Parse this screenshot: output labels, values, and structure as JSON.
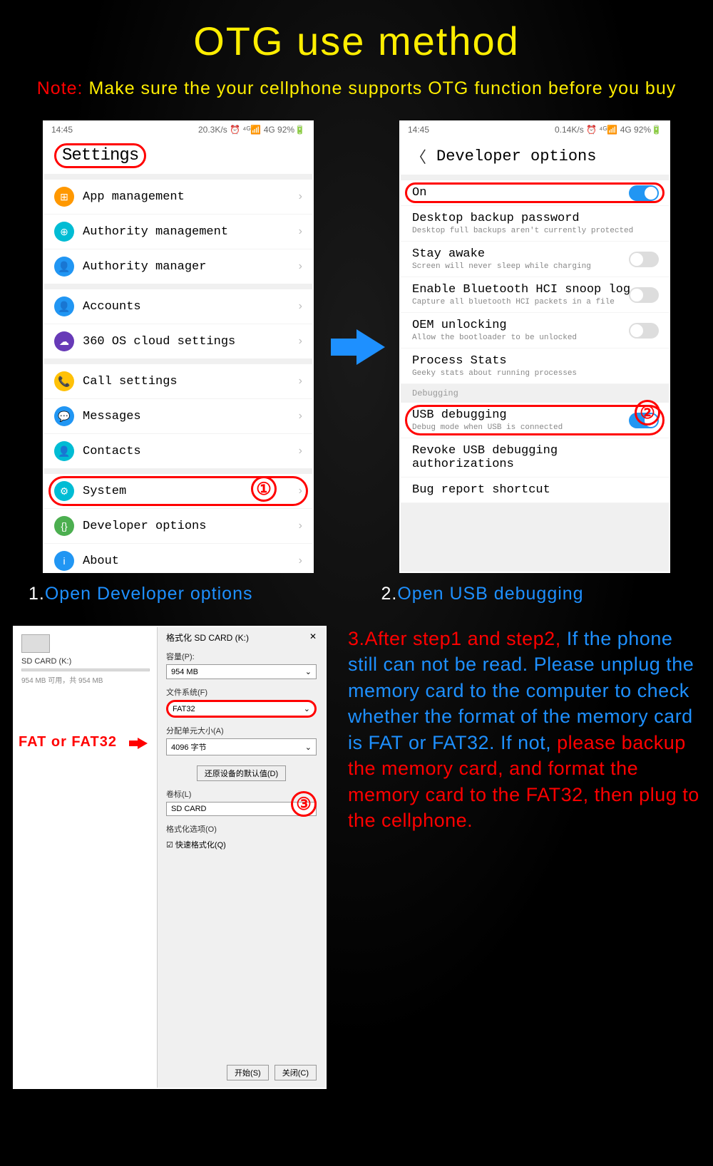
{
  "title": "OTG use method",
  "note_label": "Note:",
  "note_text": "Make sure the your cellphone supports OTG function before you buy",
  "phone1": {
    "status_time": "14:45",
    "status_right": "20.3K/s ⏰ ⁴ᴳ📶 4G 92%🔋",
    "header": "Settings",
    "groups": [
      [
        {
          "icon": "⊞",
          "color": "#ff9800",
          "label": "App management"
        },
        {
          "icon": "⊕",
          "color": "#00bcd4",
          "label": "Authority management"
        },
        {
          "icon": "👤",
          "color": "#2196f3",
          "label": "Authority manager"
        }
      ],
      [
        {
          "icon": "👤",
          "color": "#2196f3",
          "label": "Accounts"
        },
        {
          "icon": "☁",
          "color": "#673ab7",
          "label": "360 OS cloud settings"
        }
      ],
      [
        {
          "icon": "📞",
          "color": "#ffc107",
          "label": "Call settings"
        },
        {
          "icon": "💬",
          "color": "#2196f3",
          "label": "Messages"
        },
        {
          "icon": "👤",
          "color": "#00bcd4",
          "label": "Contacts"
        }
      ],
      [
        {
          "icon": "⚙",
          "color": "#00bcd4",
          "label": "System",
          "highlight": true
        },
        {
          "icon": "{}",
          "color": "#4caf50",
          "label": "Developer options"
        },
        {
          "icon": "i",
          "color": "#2196f3",
          "label": "About"
        }
      ]
    ]
  },
  "phone2": {
    "status_time": "14:45",
    "status_right": "0.14K/s ⏰ ⁴ᴳ📶 4G 92%🔋",
    "header": "Developer options",
    "rows": [
      {
        "title": "On",
        "sub": "",
        "toggle": "on",
        "highlight": true
      },
      {
        "title": "Desktop backup password",
        "sub": "Desktop full backups aren't currently protected"
      },
      {
        "title": "Stay awake",
        "sub": "Screen will never sleep while charging",
        "toggle": "off"
      },
      {
        "title": "Enable Bluetooth HCI snoop log",
        "sub": "Capture all bluetooth HCI packets in a file",
        "toggle": "off"
      },
      {
        "title": "OEM unlocking",
        "sub": "Allow the bootloader to be unlocked",
        "toggle": "off"
      },
      {
        "title": "Process Stats",
        "sub": "Geeky stats about running processes"
      }
    ],
    "debug_label": "Debugging",
    "debug_rows": [
      {
        "title": "USB debugging",
        "sub": "Debug mode when USB is connected",
        "toggle": "on",
        "highlight": true
      },
      {
        "title": "Revoke USB debugging authorizations",
        "sub": ""
      },
      {
        "title": "Bug report shortcut",
        "sub": ""
      }
    ]
  },
  "caption1_num": "1.",
  "caption1_text": "Open Developer options",
  "caption2_num": "2.",
  "caption2_text": "Open USB debugging",
  "format": {
    "drive_label": "SD CARD (K:)",
    "drive_sub": "954 MB 可用，共 954 MB",
    "dlg_title": "格式化 SD CARD (K:)",
    "capacity_label": "容量(P):",
    "capacity_value": "954 MB",
    "fs_label": "文件系统(F)",
    "fs_value": "FAT32",
    "alloc_label": "分配单元大小(A)",
    "alloc_value": "4096 字节",
    "restore_btn": "还原设备的默认值(D)",
    "vol_label": "卷标(L)",
    "vol_value": "SD CARD",
    "opt_label": "格式化选项(O)",
    "quick_label": "快速格式化(Q)",
    "start_btn": "开始(S)",
    "close_btn": "关闭(C)",
    "fat_hint": "FAT or FAT32"
  },
  "instr_num": "3.",
  "instr_red1": "After step1 and step2,",
  "instr_blue1": "If the phone still can not be read. Please unplug the memory card to the computer to check whether the format of the memory card is FAT or FAT32. If not, ",
  "instr_red2": "please backup the memory card, and format the memory card to the FAT32, then plug to the cellphone.",
  "num1": "①",
  "num2": "②",
  "num3": "③"
}
